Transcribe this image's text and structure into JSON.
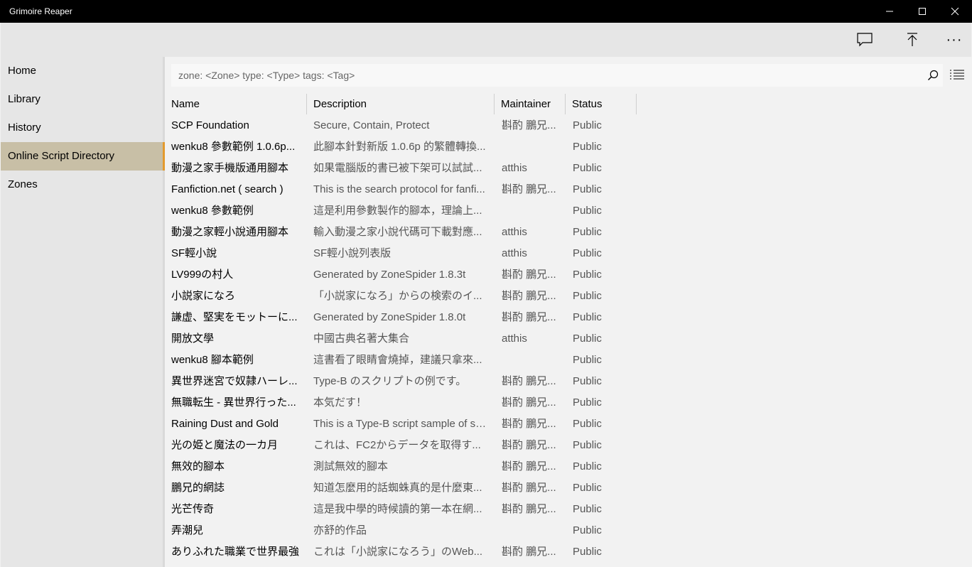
{
  "window": {
    "title": "Grimoire Reaper"
  },
  "commands": {
    "feedback_icon": "chat-bubble",
    "upload_icon": "upload-arrow",
    "more_label": "···"
  },
  "nav": {
    "items": [
      {
        "label": "Home"
      },
      {
        "label": "Library"
      },
      {
        "label": "History"
      },
      {
        "label": "Online Script Directory"
      },
      {
        "label": "Zones"
      }
    ],
    "selected_index": 3
  },
  "search": {
    "placeholder": "zone: <Zone> type: <Type> tags: <Tag>"
  },
  "table": {
    "columns": [
      "Name",
      "Description",
      "Maintainer",
      "Status"
    ],
    "rows": [
      {
        "name": "SCP Foundation",
        "desc": "Secure, Contain, Protect",
        "maint": "斟酌 鵬兄...",
        "status": "Public"
      },
      {
        "name": "wenku8 參數範例 1.0.6p...",
        "desc": "此腳本針對新版 1.0.6p 的繁體轉換...",
        "maint": "",
        "status": "Public"
      },
      {
        "name": "動漫之家手機版通用腳本",
        "desc": "如果電腦版的書已被下架可以試試...",
        "maint": "atthis",
        "status": "Public"
      },
      {
        "name": "Fanfiction.net ( search )",
        "desc": "This is the search protocol for fanfi...",
        "maint": "斟酌 鵬兄...",
        "status": "Public"
      },
      {
        "name": "wenku8 參數範例",
        "desc": "這是利用參數製作的腳本，理論上...",
        "maint": "",
        "status": "Public"
      },
      {
        "name": "動漫之家輕小說通用腳本",
        "desc": "輸入動漫之家小說代碼可下載對應...",
        "maint": "atthis",
        "status": "Public"
      },
      {
        "name": "SF輕小說",
        "desc": "SF輕小說列表版",
        "maint": "atthis",
        "status": "Public"
      },
      {
        "name": "LV999の村人",
        "desc": "Generated by ZoneSpider 1.8.3t",
        "maint": "斟酌 鵬兄...",
        "status": "Public"
      },
      {
        "name": "小説家になろ",
        "desc": "「小説家になろ」からの検索のイ...",
        "maint": "斟酌 鵬兄...",
        "status": "Public"
      },
      {
        "name": "謙虚、堅実をモットーに...",
        "desc": "Generated by ZoneSpider 1.8.0t",
        "maint": "斟酌 鵬兄...",
        "status": "Public"
      },
      {
        "name": "開放文學",
        "desc": "中國古典名著大集合",
        "maint": "atthis",
        "status": "Public"
      },
      {
        "name": "wenku8 腳本範例",
        "desc": "這書看了眼睛會燒掉，建議只拿來...",
        "maint": "",
        "status": "Public"
      },
      {
        "name": "異世界迷宮で奴隷ハーレ...",
        "desc": "Type-B のスクリプトの例です。",
        "maint": "斟酌 鵬兄...",
        "status": "Public"
      },
      {
        "name": "無職転生 - 異世界行った...",
        "desc": "本気だす！",
        "maint": "斟酌 鵬兄...",
        "status": "Public"
      },
      {
        "name": "Raining Dust and Gold",
        "desc": "This is a Type-B script sample of sh...",
        "maint": "斟酌 鵬兄...",
        "status": "Public"
      },
      {
        "name": "光の姫と魔法の一カ月",
        "desc": "これは、FC2からデータを取得す...",
        "maint": "斟酌 鵬兄...",
        "status": "Public"
      },
      {
        "name": "無效的腳本",
        "desc": "測試無效的腳本",
        "maint": "斟酌 鵬兄...",
        "status": "Public"
      },
      {
        "name": "鵬兄的網誌",
        "desc": "知道怎麼用的話蜘蛛真的是什麼東...",
        "maint": "斟酌 鵬兄...",
        "status": "Public"
      },
      {
        "name": "光芒传奇",
        "desc": "這是我中學的時候讀的第一本在網...",
        "maint": "斟酌 鵬兄...",
        "status": "Public"
      },
      {
        "name": "弄潮兒",
        "desc": "亦舒的作品",
        "maint": "",
        "status": "Public"
      },
      {
        "name": "ありふれた職業で世界最強",
        "desc": "これは「小説家になろう」のWeb...",
        "maint": "斟酌 鵬兄...",
        "status": "Public"
      }
    ]
  },
  "colors": {
    "titlebar": "#000000",
    "selected_nav": "#c8bfa6",
    "accent": "#e39a2e"
  }
}
